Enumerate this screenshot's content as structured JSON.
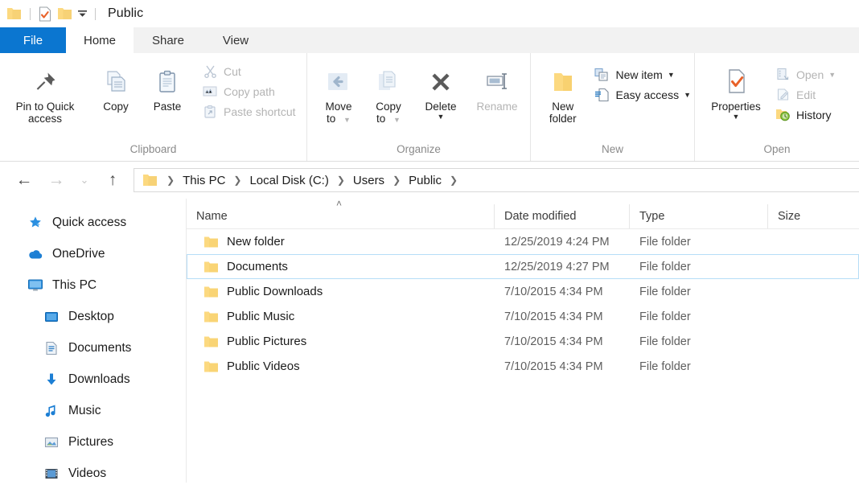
{
  "titlebar": {
    "title": "Public",
    "quick_access": [
      {
        "name": "folder-icon",
        "kind": "folder"
      },
      {
        "name": "properties-icon",
        "kind": "doc-check"
      },
      {
        "name": "new-folder-icon",
        "kind": "folder"
      }
    ],
    "customize_caret": "▾"
  },
  "tabs": [
    {
      "id": "file",
      "label": "File",
      "active": false
    },
    {
      "id": "home",
      "label": "Home",
      "active": true
    },
    {
      "id": "share",
      "label": "Share",
      "active": false
    },
    {
      "id": "view",
      "label": "View",
      "active": false
    }
  ],
  "ribbon": {
    "groups": [
      {
        "id": "clipboard",
        "label": "Clipboard",
        "big": [
          {
            "id": "pin-to-quick-access",
            "label": "Pin to Quick\naccess",
            "line1": "Pin to Quick",
            "line2": "access",
            "disabled": false
          },
          {
            "id": "copy",
            "label": "Copy",
            "line1": "Copy",
            "line2": "",
            "disabled": false
          },
          {
            "id": "paste",
            "label": "Paste",
            "line1": "Paste",
            "line2": "",
            "disabled": false
          }
        ],
        "small": [
          {
            "id": "cut",
            "label": "Cut",
            "disabled": true,
            "caret": false
          },
          {
            "id": "copy-path",
            "label": "Copy path",
            "disabled": true,
            "caret": false
          },
          {
            "id": "paste-shortcut",
            "label": "Paste shortcut",
            "disabled": true,
            "caret": false
          }
        ]
      },
      {
        "id": "organize",
        "label": "Organize",
        "big": [
          {
            "id": "move-to",
            "label": "Move to",
            "line1": "Move",
            "line2": "to",
            "disabled": true,
            "caret": true
          },
          {
            "id": "copy-to",
            "label": "Copy to",
            "line1": "Copy",
            "line2": "to",
            "disabled": true,
            "caret": true
          },
          {
            "id": "delete",
            "label": "Delete",
            "line1": "Delete",
            "line2": "",
            "disabled": false,
            "caret": true
          },
          {
            "id": "rename",
            "label": "Rename",
            "line1": "Rename",
            "line2": "",
            "disabled": true,
            "caret": false
          }
        ],
        "small": []
      },
      {
        "id": "new",
        "label": "New",
        "big": [
          {
            "id": "new-folder",
            "label": "New folder",
            "line1": "New",
            "line2": "folder",
            "disabled": false
          }
        ],
        "small": [
          {
            "id": "new-item",
            "label": "New item",
            "disabled": false,
            "caret": true
          },
          {
            "id": "easy-access",
            "label": "Easy access",
            "disabled": false,
            "caret": true
          }
        ]
      },
      {
        "id": "open",
        "label": "Open",
        "big": [
          {
            "id": "properties",
            "label": "Properties",
            "line1": "Properties",
            "line2": "",
            "disabled": false,
            "caret": true
          }
        ],
        "small": [
          {
            "id": "open",
            "label": "Open",
            "disabled": true,
            "caret": true
          },
          {
            "id": "edit",
            "label": "Edit",
            "disabled": true,
            "caret": false
          },
          {
            "id": "history",
            "label": "History",
            "disabled": false,
            "caret": false
          }
        ]
      }
    ]
  },
  "addressbar": {
    "back_icon": "←",
    "forward_icon": "→",
    "recent_icon": "⌄",
    "up_icon": "↑",
    "separator": "❯",
    "crumbs": [
      "This PC",
      "Local Disk (C:)",
      "Users",
      "Public"
    ]
  },
  "sidebar": {
    "items": [
      {
        "id": "quick-access",
        "label": "Quick access",
        "icon": "star-icon",
        "indent": false
      },
      {
        "id": "onedrive",
        "label": "OneDrive",
        "icon": "cloud-icon",
        "indent": false
      },
      {
        "id": "this-pc",
        "label": "This PC",
        "icon": "monitor-icon",
        "indent": false
      },
      {
        "id": "desktop",
        "label": "Desktop",
        "icon": "desktop-icon",
        "indent": true
      },
      {
        "id": "documents",
        "label": "Documents",
        "icon": "document-icon",
        "indent": true
      },
      {
        "id": "downloads",
        "label": "Downloads",
        "icon": "download-icon",
        "indent": true
      },
      {
        "id": "music",
        "label": "Music",
        "icon": "music-icon",
        "indent": true
      },
      {
        "id": "pictures",
        "label": "Pictures",
        "icon": "picture-icon",
        "indent": true
      },
      {
        "id": "videos",
        "label": "Videos",
        "icon": "video-icon",
        "indent": true
      }
    ]
  },
  "filelist": {
    "columns": [
      {
        "id": "name",
        "label": "Name",
        "sorted": "asc",
        "sort_caret": "˄"
      },
      {
        "id": "date",
        "label": "Date modified"
      },
      {
        "id": "type",
        "label": "Type"
      },
      {
        "id": "size",
        "label": "Size"
      }
    ],
    "rows": [
      {
        "name": "New folder",
        "date": "12/25/2019 4:24 PM",
        "type": "File folder",
        "size": "",
        "selected": false
      },
      {
        "name": "Documents",
        "date": "12/25/2019 4:27 PM",
        "type": "File folder",
        "size": "",
        "selected": true
      },
      {
        "name": "Public Downloads",
        "date": "7/10/2015 4:34 PM",
        "type": "File folder",
        "size": "",
        "selected": false
      },
      {
        "name": "Public Music",
        "date": "7/10/2015 4:34 PM",
        "type": "File folder",
        "size": "",
        "selected": false
      },
      {
        "name": "Public Pictures",
        "date": "7/10/2015 4:34 PM",
        "type": "File folder",
        "size": "",
        "selected": false
      },
      {
        "name": "Public Videos",
        "date": "7/10/2015 4:34 PM",
        "type": "File folder",
        "size": "",
        "selected": false
      }
    ]
  },
  "colors": {
    "accent": "#0b76d0",
    "folder": "#fcd980",
    "selection_border": "#b6ddf7",
    "icon_blue": "#1d7fd4"
  }
}
